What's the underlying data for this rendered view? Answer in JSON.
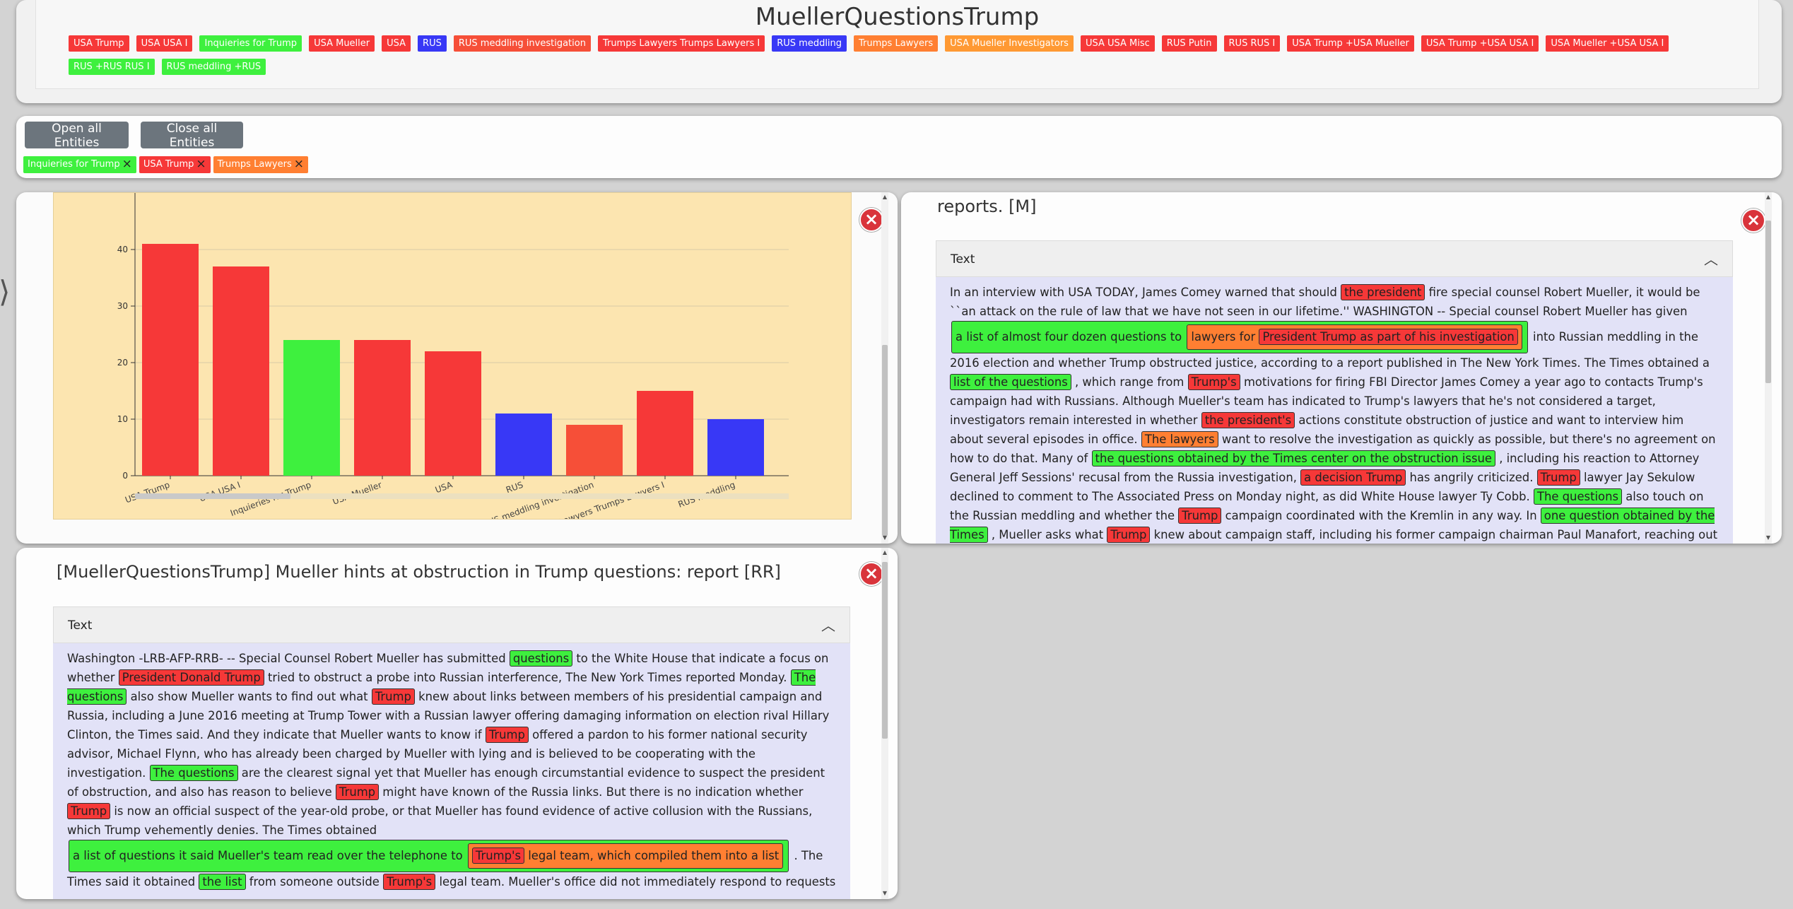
{
  "app": {
    "title": "MuellerQuestionsTrump"
  },
  "legend_tags": [
    {
      "label": "USA Trump",
      "color": "#f63838"
    },
    {
      "label": "USA USA I",
      "color": "#f63838"
    },
    {
      "label": "Inquieries for Trump",
      "color": "#3ef03e"
    },
    {
      "label": "USA Mueller",
      "color": "#f63838"
    },
    {
      "label": "USA",
      "color": "#f63838"
    },
    {
      "label": "RUS",
      "color": "#3838f6"
    },
    {
      "label": "RUS meddling investigation",
      "color": "#f64f38"
    },
    {
      "label": "Trumps Lawyers Trumps Lawyers I",
      "color": "#f63838"
    },
    {
      "label": "RUS meddling",
      "color": "#3838f6"
    },
    {
      "label": "Trumps Lawyers",
      "color": "#ff7f32"
    },
    {
      "label": "USA Mueller Investigators",
      "color": "#ff9933"
    },
    {
      "label": "USA USA Misc",
      "color": "#f63838"
    },
    {
      "label": "RUS Putin",
      "color": "#f63838"
    },
    {
      "label": "RUS RUS I",
      "color": "#f63838"
    },
    {
      "label": "USA Trump +USA Mueller",
      "color": "#f63838"
    },
    {
      "label": "USA Trump +USA USA I",
      "color": "#f63838"
    },
    {
      "label": "USA Mueller +USA USA I",
      "color": "#f63838"
    },
    {
      "label": "RUS +RUS RUS I",
      "color": "#3ef03e"
    },
    {
      "label": "RUS meddling +RUS",
      "color": "#3ef03e"
    }
  ],
  "controls": {
    "open_all": "Open all Entities",
    "close_all": "Close all Entities",
    "active_tags": [
      {
        "label": "Inquieries for Trump",
        "color": "#3ef03e"
      },
      {
        "label": "USA Trump",
        "color": "#f63838"
      },
      {
        "label": "Trumps Lawyers",
        "color": "#ff7f32"
      }
    ]
  },
  "chart_data": {
    "type": "bar",
    "categories": [
      "USA Trump",
      "USA USA I",
      "Inquieries for Trump",
      "USA Mueller",
      "USA",
      "RUS",
      "RUS meddling investigation",
      "Trumps Lawyers Trumps Lawyers I",
      "RUS meddling"
    ],
    "tick_labels": [
      "USA Trump",
      "USA USA I",
      "Inquieries for Trump",
      "USA Mueller",
      "USA",
      "RUS",
      "RUS meddling investigation",
      "Trumps Lawyers Trumps Lawyers I",
      "RUS meddling"
    ],
    "values": [
      41,
      37,
      24,
      24,
      22,
      11,
      9,
      15,
      10
    ],
    "colors": [
      "#f63838",
      "#f63838",
      "#3ef03e",
      "#f63838",
      "#f63838",
      "#3838f6",
      "#f64f38",
      "#f63838",
      "#3838f6"
    ],
    "yticks": [
      0,
      10,
      20,
      30,
      40
    ],
    "ylim": [
      0,
      50
    ],
    "grid": true
  },
  "right_card": {
    "title": "reports. [M]",
    "section_label": "Text"
  },
  "bottom_card": {
    "title": "[MuellerQuestionsTrump] Mueller hints at obstruction in Trump questions: report [RR]",
    "section_label": "Text"
  },
  "right_text": [
    "In an interview with USA TODAY, James Comey warned that should ",
    "the president",
    " fire special counsel Robert Mueller, it would be ``an attack on the rule of law that we have not seen in our lifetime.'' WASHINGTON -- Special counsel Robert Mueller has given ",
    "a list of almost four dozen questions to ",
    "lawyers for ",
    "President Trump as part of his investigation",
    " into Russian meddling in the 2016 election and whether Trump obstructed justice, according to a report published in The New York Times. The Times obtained a ",
    "list of the questions",
    " , which range from ",
    "Trump's",
    " motivations for firing FBI Director James Comey a year ago to contacts Trump's campaign had with Russians. Although Mueller's team has indicated to Trump's lawyers that he's not considered a target, investigators remain interested in whether ",
    "the president's",
    " actions constitute obstruction of justice and want to interview him about several episodes in office. ",
    "The lawyers",
    " want to resolve the investigation as quickly as possible, but there's no agreement on how to do that. Many of ",
    "the questions obtained by the Times center on the obstruction issue",
    " , including his reaction to Attorney General Jeff Sessions' recusal from the Russia investigation, ",
    "a decision Trump",
    " has angrily criticized. ",
    "Trump",
    " lawyer Jay Sekulow declined to comment to The Associated Press on Monday night, as did White House lawyer Ty Cobb. ",
    "The questions",
    " also touch on the Russian meddling and whether the ",
    "Trump",
    " campaign coordinated with the Kremlin in any way. In ",
    "one question obtained by the Times",
    " , Mueller asks what ",
    "Trump",
    " knew about campaign staff, including his former campaign chairman Paul Manafort, reaching out to Moscow. Mueller has"
  ],
  "bottom_text": [
    "Washington -LRB-AFP-RRB- -- Special Counsel Robert Mueller has submitted ",
    "questions",
    " to the White House that indicate a focus on whether ",
    "President Donald Trump",
    " tried to obstruct a probe into Russian interference, The New York Times reported Monday. ",
    "The questions",
    " also show Mueller wants to find out what ",
    "Trump",
    " knew about links between members of his presidential campaign and Russia, including a June 2016 meeting at Trump Tower with a Russian lawyer offering damaging information on election rival Hillary Clinton, the Times said. And they indicate that Mueller wants to know if ",
    "Trump",
    " offered a pardon to his former national security advisor, Michael Flynn, who has already been charged by Mueller with lying and is believed to be cooperating with the investigation. ",
    "The questions",
    " are the clearest signal yet that Mueller has enough circumstantial evidence to suspect the president of obstruction, and also has reason to believe ",
    "Trump",
    " might have known of the Russia links. But there is no indication whether ",
    "Trump",
    " is now an official suspect of the year-old probe, or that Mueller has found evidence of active collusion with the Russians, which Trump vehemently denies. The Times obtained ",
    "a list of questions it said Mueller's team read over the telephone to ",
    "Trump's",
    " legal team, which compiled them into a list",
    " . The Times said it obtained ",
    "the list",
    " from someone outside ",
    "Trump's",
    " legal team. Mueller's office did not immediately respond to requests"
  ]
}
